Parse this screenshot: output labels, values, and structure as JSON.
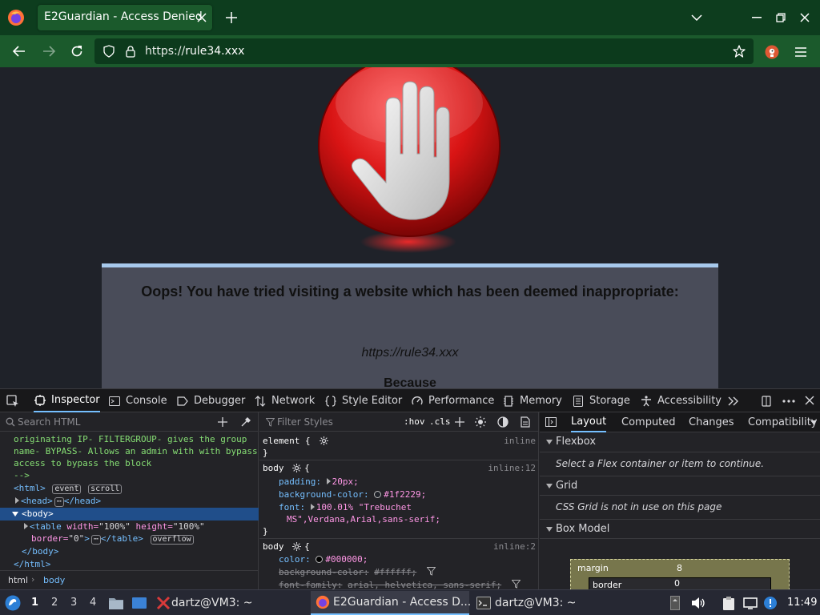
{
  "browser": {
    "tab_title": "E2Guardian - Access Denied",
    "url_scheme": "https://",
    "url_host": "rule34.xxx"
  },
  "page": {
    "heading": "Oops! You have tried visiting a website which has been deemed inappropriate:",
    "blocked_url": "https://rule34.xxx",
    "because_label": "Because",
    "accent_color": "#a7c9ec",
    "box_color": "#494c59"
  },
  "devtools": {
    "tabs": [
      {
        "label": "Inspector",
        "icon": "inspector-icon"
      },
      {
        "label": "Console",
        "icon": "console-icon"
      },
      {
        "label": "Debugger",
        "icon": "debugger-icon"
      },
      {
        "label": "Network",
        "icon": "network-icon"
      },
      {
        "label": "Style Editor",
        "icon": "style-editor-icon"
      },
      {
        "label": "Performance",
        "icon": "performance-icon"
      },
      {
        "label": "Memory",
        "icon": "memory-icon"
      },
      {
        "label": "Storage",
        "icon": "storage-icon"
      },
      {
        "label": "Accessibility",
        "icon": "accessibility-icon"
      }
    ],
    "inspector": {
      "search_placeholder": "Search HTML",
      "markup": {
        "comment_1": "originating IP- FILTERGROUP- gives the group",
        "comment_2": "name- BYPASS- Allows an admin with with bypass",
        "comment_3": "access to bypass the block",
        "comment_end": "-->",
        "html_open": "<html>",
        "badge_event": "event",
        "badge_scroll": "scroll",
        "head": "<head>",
        "head_close": "</head>",
        "body_open": "<body>",
        "table_open": "<table",
        "attr_width": "width=",
        "val_width": "\"100%\"",
        "attr_height": "height=",
        "val_height": "\"100%\"",
        "attr_border": "border=",
        "val_border": "\"0\"",
        "table_close": "</table>",
        "badge_overflow": "overflow",
        "body_close": "</body>",
        "html_close": "</html>"
      },
      "breadcrumbs": [
        "html",
        "body"
      ]
    },
    "rules": {
      "filter_placeholder": "Filter Styles",
      "hov": ":hov",
      "cls": ".cls",
      "element_selector": "element {",
      "element_source": "inline",
      "close_brace": "}",
      "body1_selector": "body",
      "body1_source": "inline:12",
      "body1_props": [
        {
          "name": "padding:",
          "value": "20px;"
        },
        {
          "name": "background-color:",
          "value": "#1f2229;"
        },
        {
          "name": "font:",
          "value": "100.01% \"Trebuchet"
        },
        {
          "name": "",
          "value": "MS\",Verdana,Arial,sans-serif;"
        }
      ],
      "body2_selector": "body",
      "body2_source": "inline:2",
      "body2_props": [
        {
          "name": "color:",
          "value": "#000000;"
        },
        {
          "name": "background-color:",
          "value": "#ffffff;"
        },
        {
          "name": "font-family:",
          "value": "arial, helvetica, sans-serif;"
        }
      ],
      "colors": {
        "bg_swatch": "#1f2229",
        "text_swatch": "#000000"
      }
    },
    "layout": {
      "tabs": [
        "Layout",
        "Computed",
        "Changes",
        "Compatibility"
      ],
      "flexbox_title": "Flexbox",
      "flexbox_msg": "Select a Flex container or item to continue.",
      "grid_title": "Grid",
      "grid_msg": "CSS Grid is not in use on this page",
      "boxmodel_title": "Box Model",
      "margin_label": "margin",
      "margin_value": "8",
      "border_label": "border",
      "border_value": "0"
    }
  },
  "taskbar": {
    "workspaces": [
      "1",
      "2",
      "3",
      "4"
    ],
    "tasks": [
      {
        "label": "dartz@VM3: ~",
        "icon": "terminal-emulator-icon"
      },
      {
        "label": "E2Guardian - Access D...",
        "icon": "firefox-icon"
      },
      {
        "label": "dartz@VM3: ~",
        "icon": "terminal-icon"
      }
    ],
    "clock": "11:49"
  }
}
